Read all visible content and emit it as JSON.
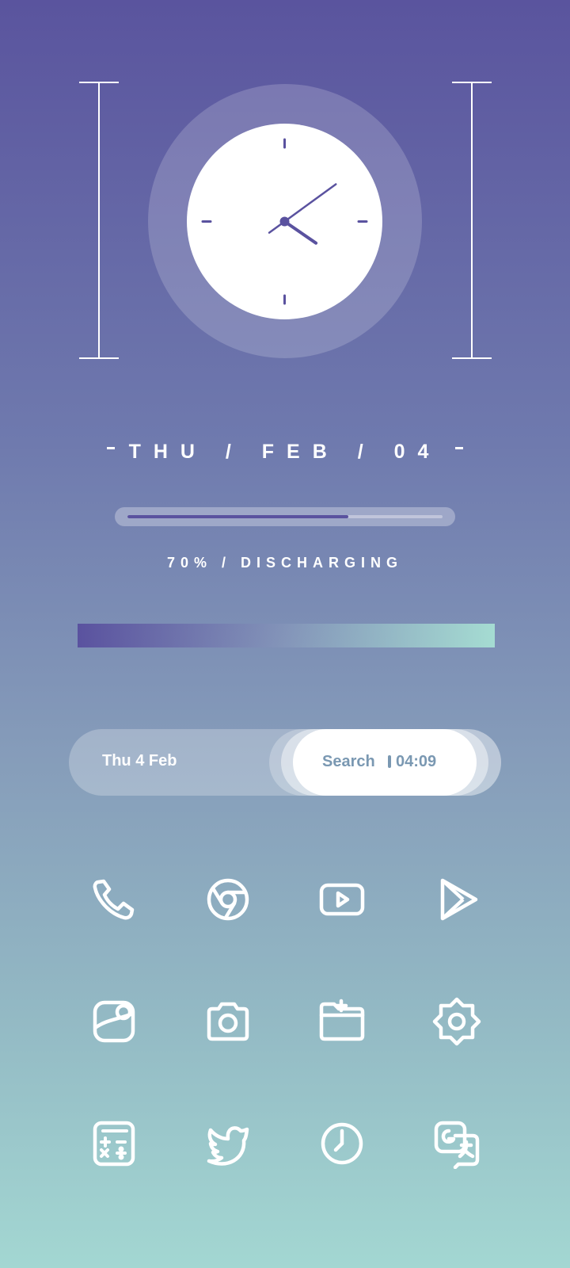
{
  "clock": {
    "hour": 4,
    "minute": 9
  },
  "date_text": "THU / FEB / 04",
  "battery": {
    "level": 0.7,
    "text": "70% / DISCHARGING"
  },
  "search_widget": {
    "date": "Thu 4 Feb",
    "search_label": "Search",
    "time": "04:09"
  },
  "icons": [
    "phone-icon",
    "chrome-icon",
    "youtube-icon",
    "play-store-icon",
    "gallery-icon",
    "camera-icon",
    "files-icon",
    "settings-icon",
    "calculator-icon",
    "twitter-icon",
    "clock-icon",
    "translate-icon"
  ],
  "colors": {
    "accent": "#5a529f",
    "mint": "#a5dcd2"
  }
}
